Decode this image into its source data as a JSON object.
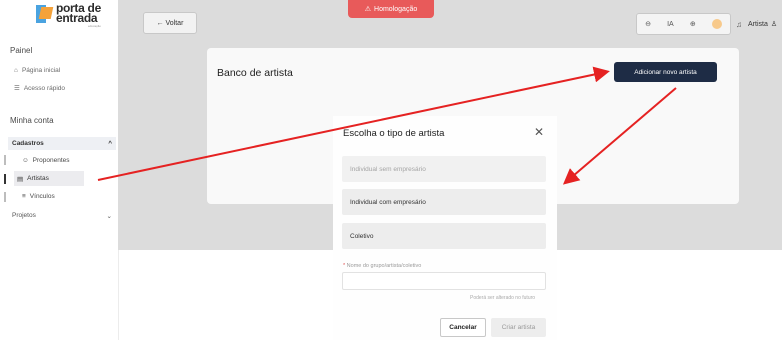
{
  "logo": {
    "line1": "porta de",
    "line2": "entrada",
    "tagline": "educação"
  },
  "sidebar": {
    "painel": "Painel",
    "pagina_inicial": "Página inicial",
    "acesso_rapido": "Acesso rápido",
    "minha_conta": "Minha conta",
    "cadastros": "Cadastros",
    "proponentes": "Proponentes",
    "artistas": "Artistas",
    "vinculos": "Vínculos",
    "projetos": "Projetos"
  },
  "header": {
    "back_label": "← Voltar",
    "env_badge": "Homologação",
    "ia_label": "IA",
    "user_label": "Artista"
  },
  "main": {
    "title": "Banco de artista",
    "add_button": "Adicionar novo artista"
  },
  "dialog": {
    "title": "Escolha o tipo de artista",
    "options": [
      "Individual sem empresário",
      "Individual com empresário",
      "Coletivo"
    ],
    "field_label": "Nome do grupo/artista/coletivo",
    "field_hint": "Poderá ser alterado no futuro",
    "cancel": "Cancelar",
    "create": "Criar artista"
  },
  "colors": {
    "primary_button": "#1e2c45",
    "badge": "#e85a5a",
    "annotation_arrow": "#e52222"
  }
}
